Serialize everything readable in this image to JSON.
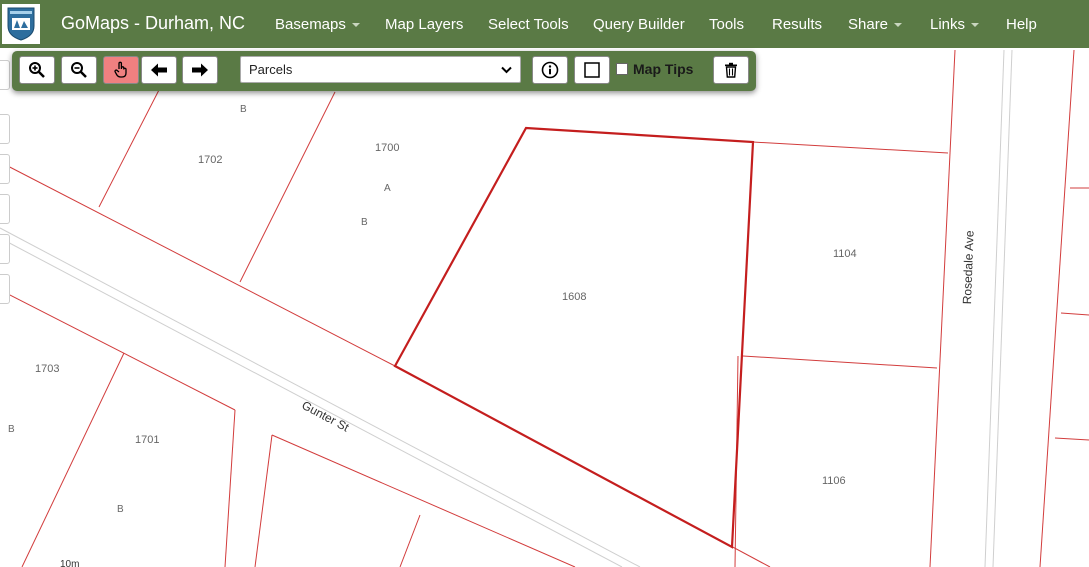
{
  "navbar": {
    "brand": "GoMaps - Durham, NC",
    "logo_icon": "city-shield-logo-icon",
    "menu": [
      {
        "label": "Basemaps",
        "dropdown": true
      },
      {
        "label": "Map Layers",
        "dropdown": false
      },
      {
        "label": "Select Tools",
        "dropdown": false
      },
      {
        "label": "Query Builder",
        "dropdown": false
      },
      {
        "label": "Tools",
        "dropdown": false
      },
      {
        "label": "Results",
        "dropdown": false
      },
      {
        "label": "Share",
        "dropdown": true
      },
      {
        "label": "Links",
        "dropdown": true
      },
      {
        "label": "Help",
        "dropdown": false
      }
    ],
    "colors": {
      "background": "#5a7a45",
      "text": "#ffffff"
    }
  },
  "toolbar": {
    "tools": [
      {
        "name": "zoom-in",
        "icon": "zoom-in-icon",
        "active": false
      },
      {
        "name": "zoom-out",
        "icon": "zoom-out-icon",
        "active": false
      },
      {
        "name": "pan",
        "icon": "hand-pointer-icon",
        "active": true
      },
      {
        "name": "previous-extent",
        "icon": "arrow-left-icon",
        "active": false
      },
      {
        "name": "next-extent",
        "icon": "arrow-right-icon",
        "active": false
      }
    ],
    "layer_select": {
      "value": "Parcels"
    },
    "identify_icon": "info-circle-icon",
    "select_rect_icon": "rectangle-select-icon",
    "map_tips": {
      "label": "Map Tips",
      "checked": false
    },
    "clear_icon": "trash-icon",
    "active_color": "#f08080"
  },
  "map": {
    "parcel_labels": [
      "1702",
      "1700",
      "1608",
      "1104",
      "1106",
      "1703",
      "1701"
    ],
    "sub_labels": [
      "B",
      "A",
      "B",
      "B",
      "B"
    ],
    "streets": [
      "Gunter St",
      "Rosedale Ave"
    ],
    "scale_text": "10m",
    "colors": {
      "parcel_line": "#d23c3c",
      "selected_parcel": "#c41e1e",
      "road_line": "#cfcfcf"
    }
  }
}
